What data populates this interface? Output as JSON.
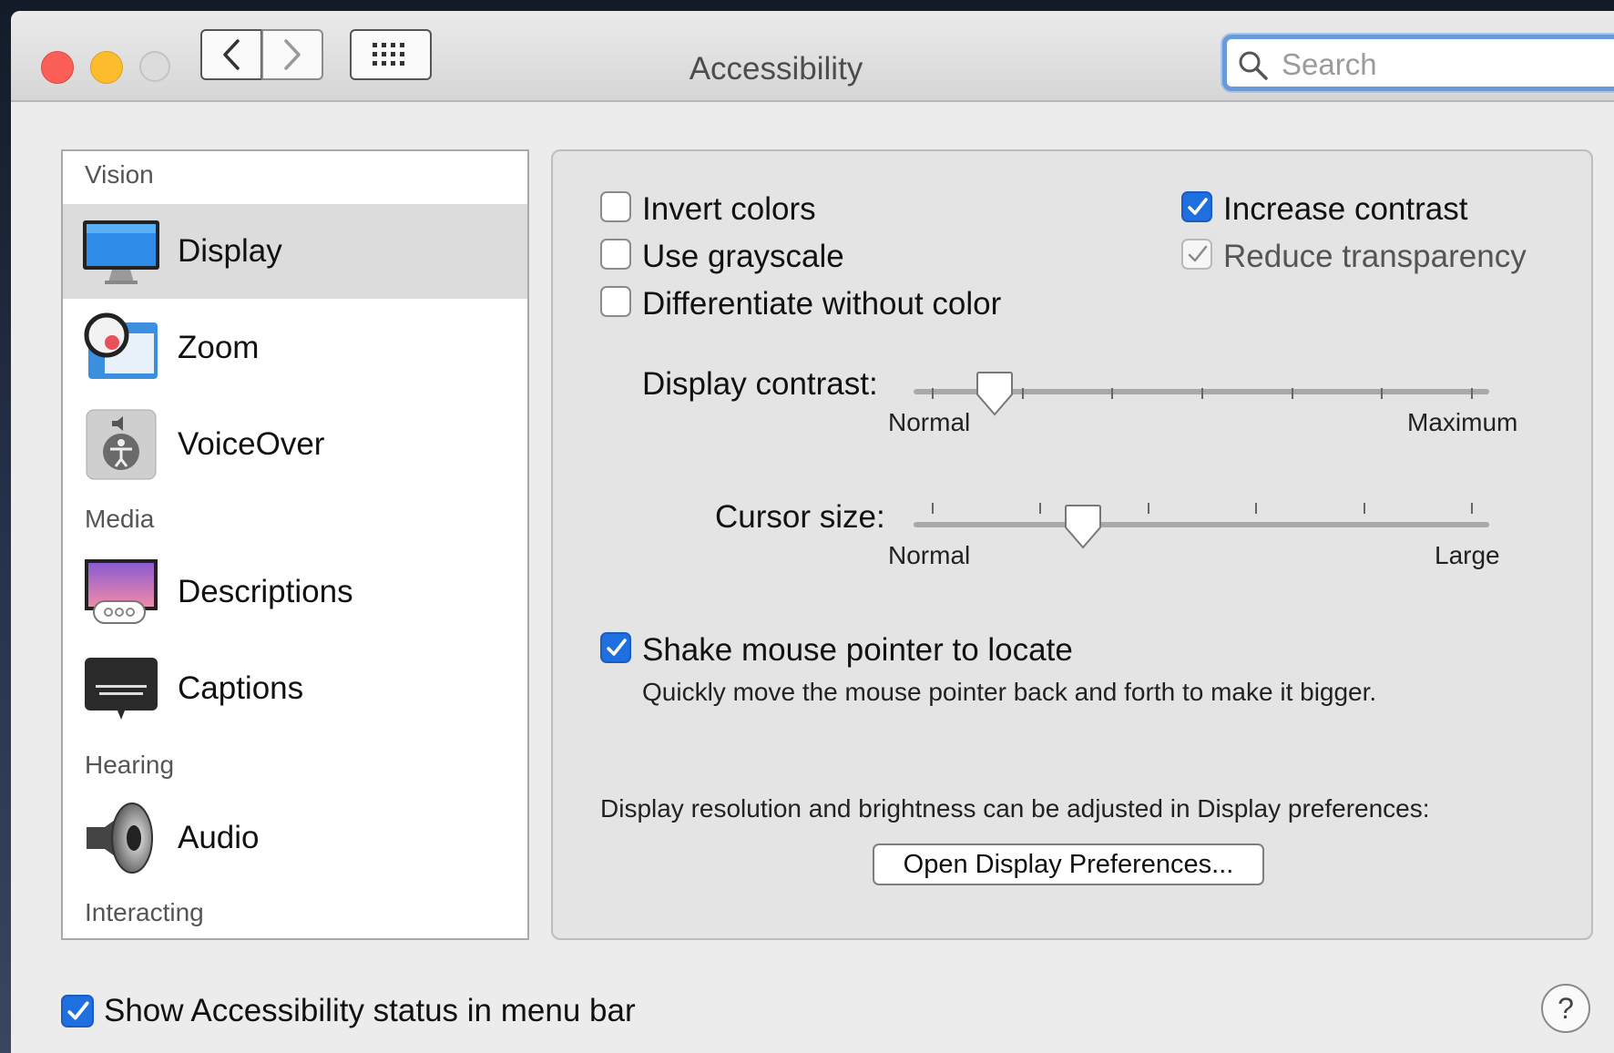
{
  "window": {
    "title": "Accessibility"
  },
  "search": {
    "placeholder": "Search",
    "value": ""
  },
  "sidebar": {
    "sections": [
      {
        "header": "Vision",
        "items": [
          "Display",
          "Zoom",
          "VoiceOver"
        ]
      },
      {
        "header": "Media",
        "items": [
          "Descriptions",
          "Captions"
        ]
      },
      {
        "header": "Hearing",
        "items": [
          "Audio"
        ]
      },
      {
        "header": "Interacting",
        "items": []
      }
    ],
    "selected": "Display",
    "labels": {
      "vision": "Vision",
      "display": "Display",
      "zoom": "Zoom",
      "voiceover": "VoiceOver",
      "media": "Media",
      "descriptions": "Descriptions",
      "captions": "Captions",
      "hearing": "Hearing",
      "audio": "Audio",
      "interacting": "Interacting"
    }
  },
  "options": {
    "invert_colors": {
      "label": "Invert colors",
      "checked": false
    },
    "use_grayscale": {
      "label": "Use grayscale",
      "checked": false
    },
    "differentiate": {
      "label": "Differentiate without color",
      "checked": false
    },
    "increase_contrast": {
      "label": "Increase contrast",
      "checked": true
    },
    "reduce_transparency": {
      "label": "Reduce transparency",
      "checked": true,
      "disabled": true
    }
  },
  "display_contrast": {
    "label": "Display contrast:",
    "min_label": "Normal",
    "max_label": "Maximum",
    "ticks": 7,
    "position_index": 0.7
  },
  "cursor_size": {
    "label": "Cursor size:",
    "min_label": "Normal",
    "max_label": "Large",
    "ticks": 6,
    "position_index": 1.4
  },
  "shake": {
    "label": "Shake mouse pointer to locate",
    "checked": true,
    "description": "Quickly move the mouse pointer back and forth to make it bigger."
  },
  "display_note": "Display resolution and brightness can be adjusted in Display preferences:",
  "open_display_button": "Open Display Preferences...",
  "footer": {
    "status_label": "Show Accessibility status in menu bar",
    "status_checked": true,
    "help": "?"
  },
  "colors": {
    "accent": "#1f6fe0",
    "selection": "#dcdcdc"
  }
}
